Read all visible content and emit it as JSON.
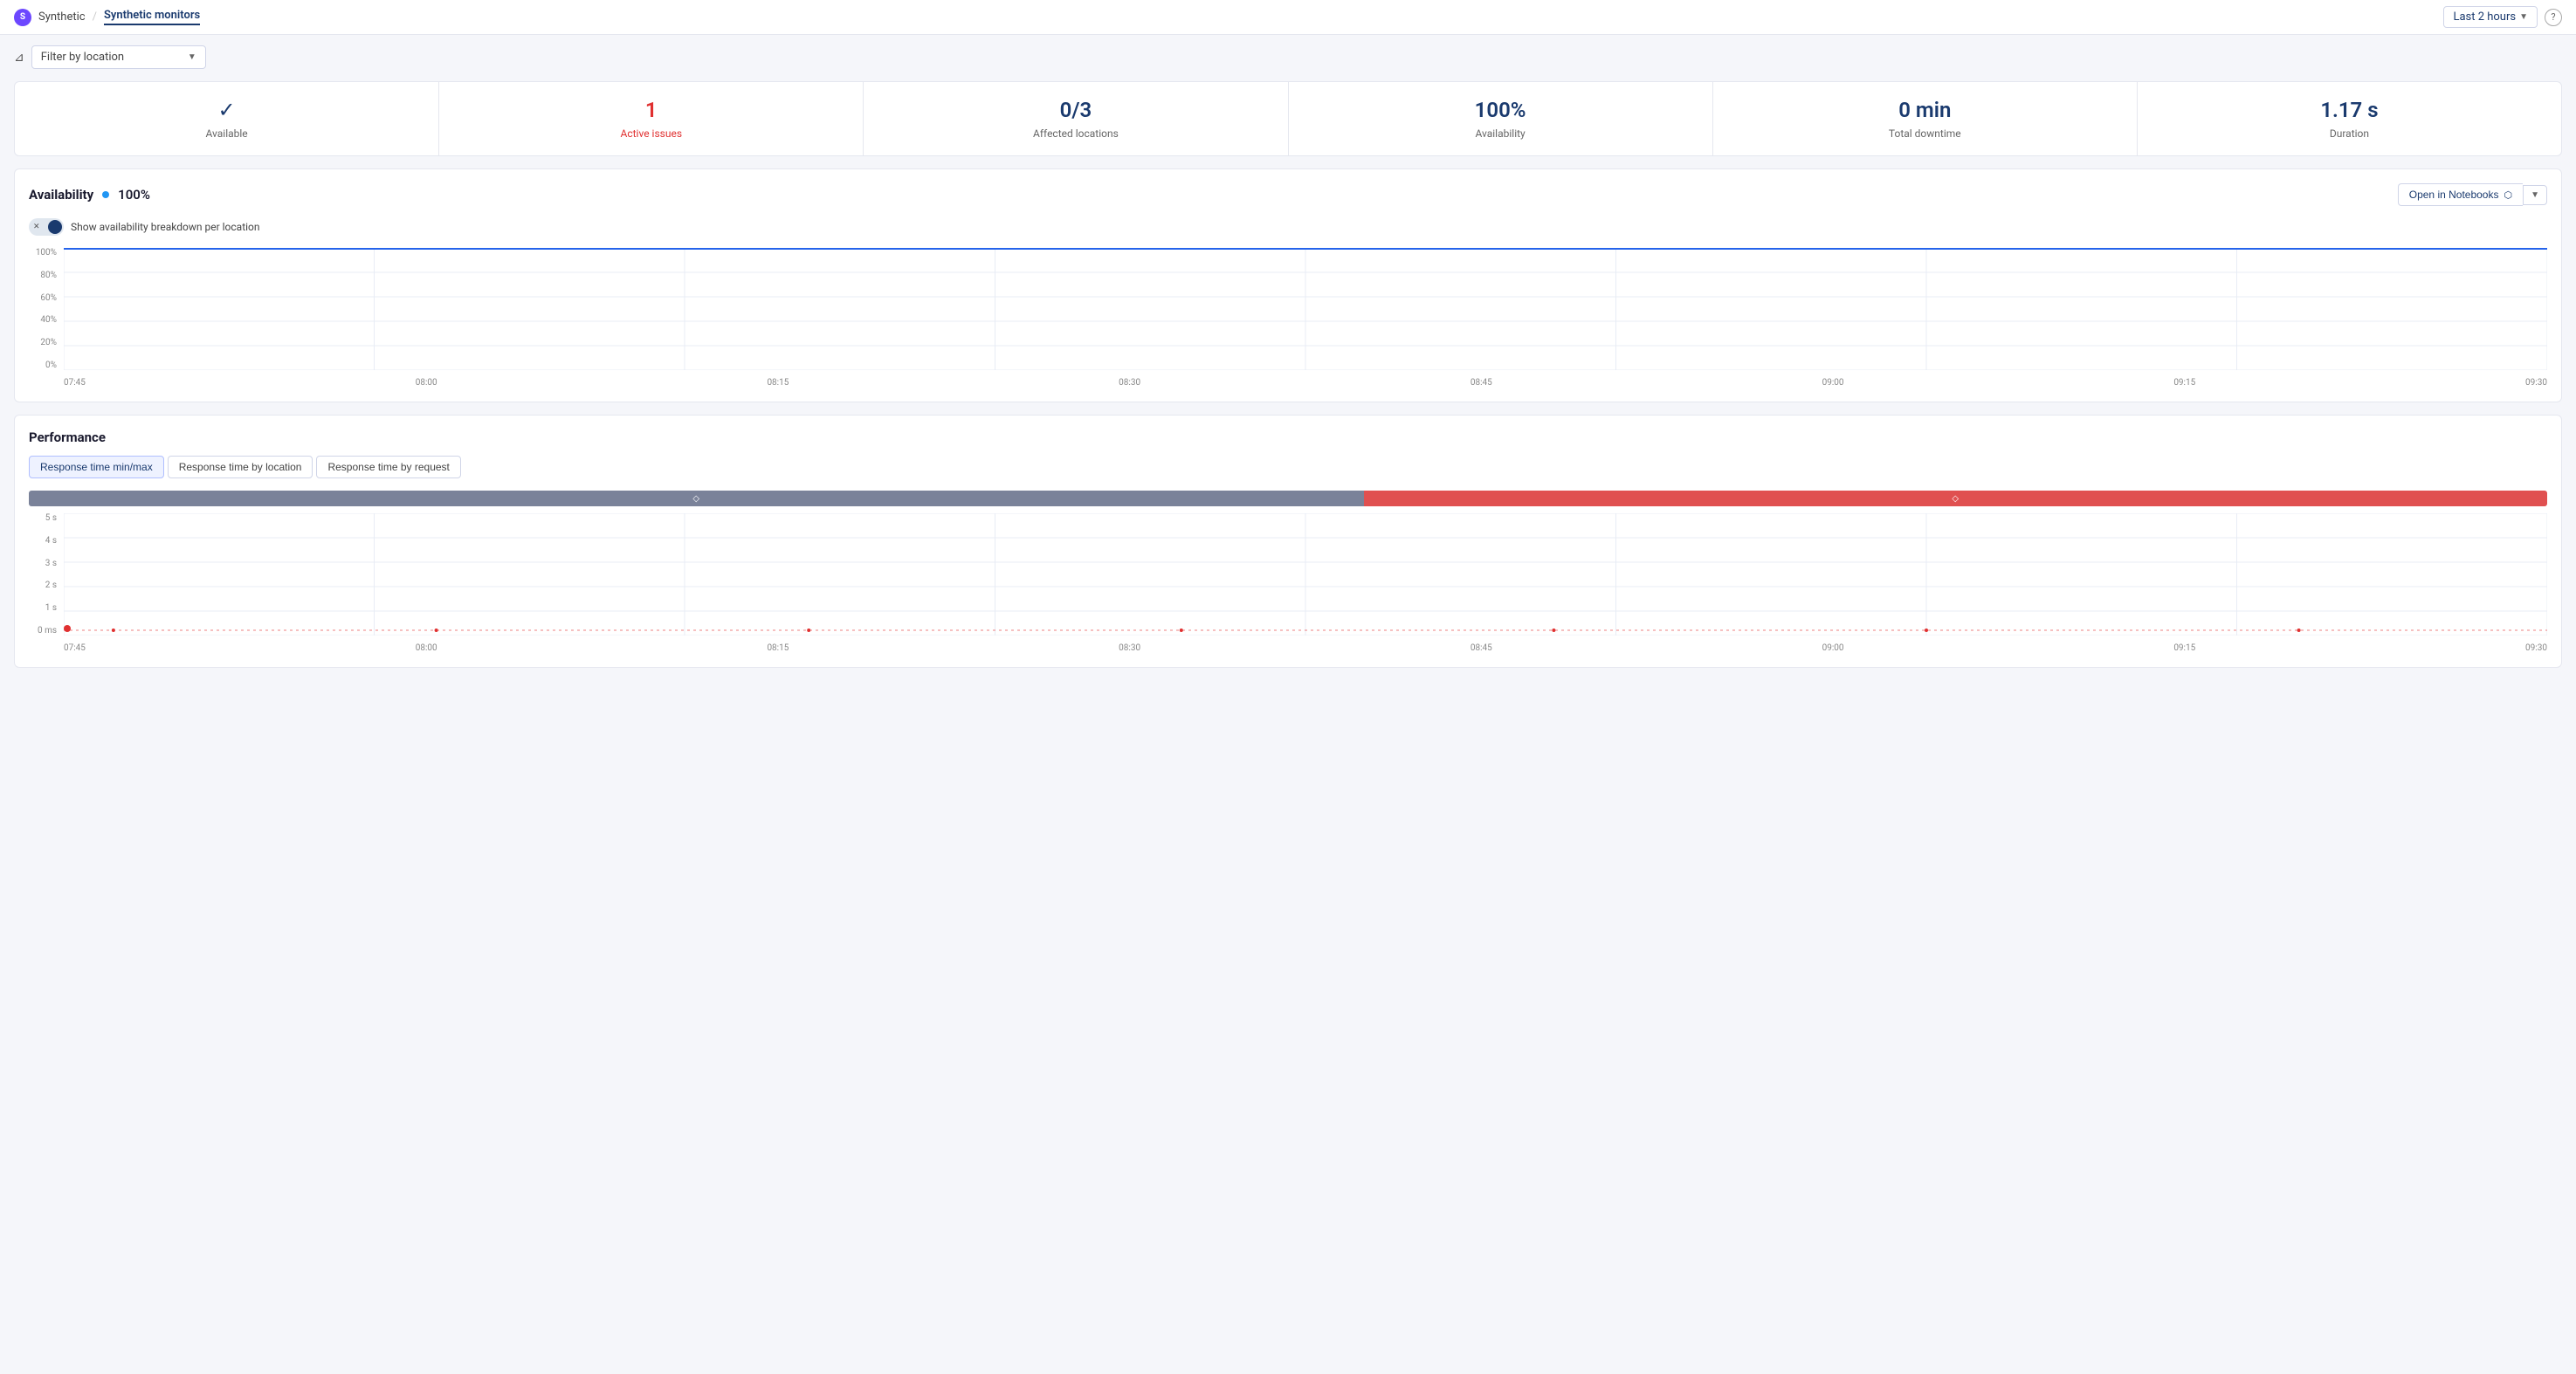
{
  "nav": {
    "app_name": "Synthetic",
    "page_name": "Synthetic monitors",
    "time_selector": "Last 2 hours",
    "help_icon": "?"
  },
  "filter": {
    "label": "Filter by location",
    "icon": "⊿"
  },
  "stats": [
    {
      "id": "available",
      "value": "✓",
      "label": "Available",
      "type": "check"
    },
    {
      "id": "active-issues",
      "value": "1",
      "label": "Active issues",
      "type": "issues"
    },
    {
      "id": "affected-locations",
      "value": "0/3",
      "label": "Affected locations",
      "type": "normal"
    },
    {
      "id": "availability",
      "value": "100%",
      "label": "Availability",
      "type": "normal"
    },
    {
      "id": "total-downtime",
      "value": "0 min",
      "label": "Total downtime",
      "type": "normal"
    },
    {
      "id": "duration",
      "value": "1.17 s",
      "label": "Duration",
      "type": "normal"
    }
  ],
  "availability_chart": {
    "title": "Availability",
    "pct": "100%",
    "open_notebooks_label": "Open in Notebooks",
    "toggle_label": "Show availability breakdown per location",
    "x_labels": [
      "07:45",
      "08:00",
      "08:15",
      "08:30",
      "08:45",
      "09:00",
      "09:15",
      "09:30"
    ],
    "y_labels": [
      "0%",
      "20%",
      "40%",
      "60%",
      "80%",
      "100%"
    ]
  },
  "performance": {
    "title": "Performance",
    "tabs": [
      {
        "id": "minmax",
        "label": "Response time min/max",
        "active": true
      },
      {
        "id": "location",
        "label": "Response time by location",
        "active": false
      },
      {
        "id": "request",
        "label": "Response time by request",
        "active": false
      }
    ],
    "x_labels": [
      "07:45",
      "08:00",
      "08:15",
      "08:30",
      "08:45",
      "09:00",
      "09:15",
      "09:30"
    ],
    "y_labels": [
      "0 ms",
      "1 s",
      "2 s",
      "3 s",
      "4 s",
      "5 s"
    ]
  }
}
